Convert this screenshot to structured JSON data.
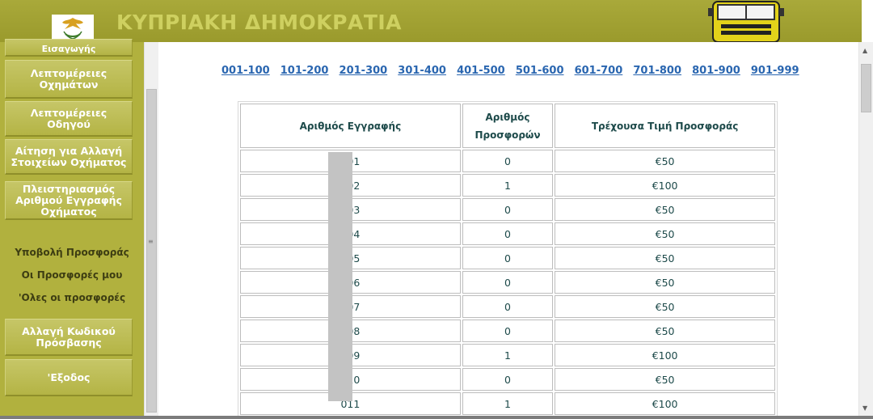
{
  "header": {
    "title": "ΚΥΠΡΙΑΚΗ ΔΗΜΟΚΡΑΤΙΑ",
    "emblem_icon": "cyprus-emblem-icon",
    "truck_icon": "truck-icon"
  },
  "sidebar": {
    "buttons_top": [
      {
        "label": "Εισαγωγής"
      },
      {
        "label": "Λεπτομέρειες Οχημάτων"
      },
      {
        "label": "Λεπτομέρειες Οδηγού"
      },
      {
        "label": "Αίτηση για Αλλαγή Στοιχείων Οχήματος"
      },
      {
        "label": "Πλειστηριασμός Αριθμού Εγγραφής Οχήματος"
      }
    ],
    "links": [
      {
        "label": "Υποβολή Προσφοράς"
      },
      {
        "label": "Οι Προσφορές μου"
      },
      {
        "label": "'Ολες οι προσφορές"
      }
    ],
    "buttons_bottom": [
      {
        "label": "Αλλαγή Κωδικού Πρόσβασης"
      },
      {
        "label": "'Εξοδος"
      }
    ]
  },
  "ranges": [
    "001-100",
    "101-200",
    "201-300",
    "301-400",
    "401-500",
    "501-600",
    "601-700",
    "701-800",
    "801-900",
    "901-999"
  ],
  "table": {
    "headers": {
      "registration": "Αριθμός Εγγραφής",
      "count_line1": "Αριθμός",
      "count_line2": "Προσφορών",
      "price": "Τρέχουσα Τιμή Προσφοράς"
    },
    "rows": [
      {
        "reg": "001",
        "count": "0",
        "price": "€50"
      },
      {
        "reg": "002",
        "count": "1",
        "price": "€100"
      },
      {
        "reg": "003",
        "count": "0",
        "price": "€50"
      },
      {
        "reg": "004",
        "count": "0",
        "price": "€50"
      },
      {
        "reg": "005",
        "count": "0",
        "price": "€50"
      },
      {
        "reg": "006",
        "count": "0",
        "price": "€50"
      },
      {
        "reg": "007",
        "count": "0",
        "price": "€50"
      },
      {
        "reg": "008",
        "count": "0",
        "price": "€50"
      },
      {
        "reg": "009",
        "count": "1",
        "price": "€100"
      },
      {
        "reg": "010",
        "count": "0",
        "price": "€50"
      },
      {
        "reg": "011",
        "count": "1",
        "price": "€100"
      }
    ]
  },
  "colors": {
    "header_bg": "#a9a93a",
    "title": "#ced060",
    "sidebar_bg": "#b1b13e",
    "link": "#2a66b0",
    "table_text": "#1d4a4a"
  }
}
